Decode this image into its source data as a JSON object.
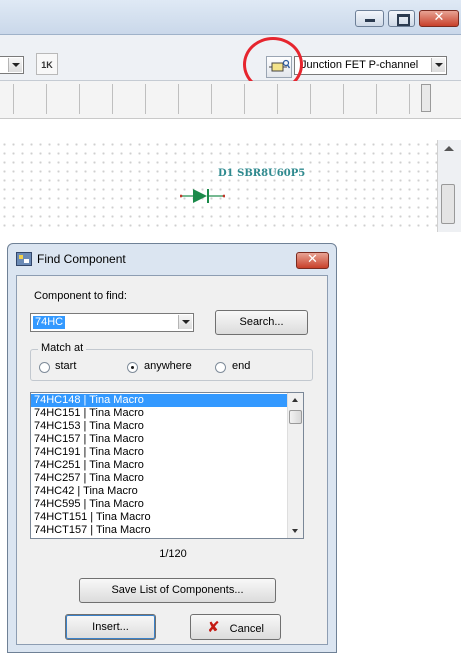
{
  "app": {
    "component_type": "Junction FET P-channel",
    "part_label": "D1 SBR8U60P5",
    "toolbar_1k_label": "1K"
  },
  "window_controls": {
    "close_glyph": "✕",
    "icons": [
      "minimize-icon",
      "maximize-icon",
      "close-icon"
    ]
  },
  "dialog": {
    "title": "Find Component",
    "component_label": "Component to find:",
    "search_value": "74HC",
    "search_button": "Search...",
    "match_at": {
      "legend": "Match at",
      "options": [
        "start",
        "anywhere",
        "end"
      ],
      "selected": "anywhere"
    },
    "results": [
      "74HC148 | Tina Macro",
      "74HC151 | Tina Macro",
      "74HC153 | Tina Macro",
      "74HC157 | Tina Macro",
      "74HC191 | Tina Macro",
      "74HC251 | Tina Macro",
      "74HC257 | Tina Macro",
      "74HC42 | Tina Macro",
      "74HC595 | Tina Macro",
      "74HCT151 | Tina Macro",
      "74HCT157 | Tina Macro"
    ],
    "selected_result": "74HC148 | Tina Macro",
    "count": "1/120",
    "save_button": "Save List of Components...",
    "insert_button": "Insert...",
    "cancel_button": "Cancel",
    "cancel_glyph": "✘"
  },
  "colors": {
    "accent_selection": "#3399ff",
    "callout_circle": "#e6252e",
    "part_label": "#2f8a8f",
    "diode": "#1b8a4a"
  }
}
